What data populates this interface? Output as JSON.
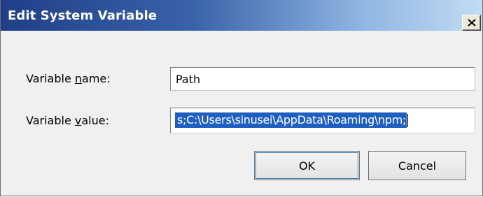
{
  "window": {
    "title": "Edit System Variable"
  },
  "fields": {
    "name": {
      "label_pre": "Variable ",
      "label_mnemonic": "n",
      "label_post": "ame:",
      "value": "Path"
    },
    "value": {
      "label_pre": "Variable ",
      "label_mnemonic": "v",
      "label_post": "alue:",
      "value": "s;C:\\Users\\sinusei\\AppData\\Roaming\\npm;"
    }
  },
  "buttons": {
    "ok": "OK",
    "cancel": "Cancel"
  },
  "colors": {
    "selection": "#1f5fbf",
    "titlebar_start": "#1f3f87",
    "titlebar_end": "#c2dcf4"
  },
  "icons": {
    "close": "close-icon"
  }
}
